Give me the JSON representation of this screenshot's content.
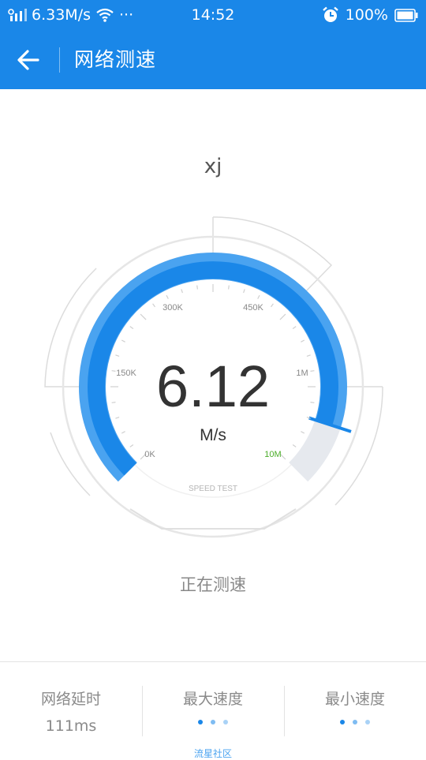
{
  "status_bar": {
    "net_speed": "6.33M/s",
    "more": "···",
    "time": "14:52",
    "battery": "100%"
  },
  "header": {
    "title": "网络测速"
  },
  "network_name": "xj",
  "gauge": {
    "speed_value": "6.12",
    "speed_unit": "M/s",
    "caption": "SPEED TEST",
    "tick_labels": [
      "0K",
      "150K",
      "300K",
      "450K",
      "1M",
      "10M"
    ],
    "progress": 0.9,
    "colors": {
      "accent": "#1a87e8",
      "arc_light": "#4aa3f0",
      "active_label": "#4cae2a",
      "remaining": "#e6e9ee"
    }
  },
  "status_text": "正在测速",
  "stats": {
    "latency_label": "网络延时",
    "latency_value": "111ms",
    "max_label": "最大速度",
    "min_label": "最小速度"
  },
  "footer": "流星社区"
}
